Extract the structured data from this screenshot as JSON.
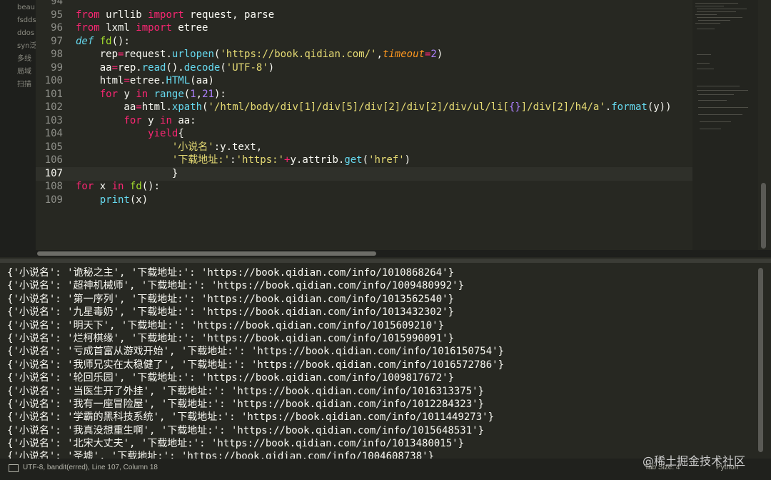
{
  "sidebar": {
    "items": [
      "beau",
      "fsdds",
      "ddos",
      "syn泛",
      "多线",
      "局域",
      "扫描"
    ]
  },
  "editor": {
    "line_numbers": [
      "94",
      "95",
      "96",
      "97",
      "98",
      "99",
      "100",
      "101",
      "102",
      "103",
      "104",
      "105",
      "106",
      "107",
      "108",
      "109"
    ],
    "active_line": "107"
  },
  "console": {
    "lines": [
      "{'小说名': '诡秘之主', '下载地址:': 'https://book.qidian.com/info/1010868264'}",
      "{'小说名': '超神机械师', '下载地址:': 'https://book.qidian.com/info/1009480992'}",
      "{'小说名': '第一序列', '下载地址:': 'https://book.qidian.com/info/1013562540'}",
      "{'小说名': '九星毒奶', '下载地址:': 'https://book.qidian.com/info/1013432302'}",
      "{'小说名': '明天下', '下载地址:': 'https://book.qidian.com/info/1015609210'}",
      "{'小说名': '烂柯棋缘', '下载地址:': 'https://book.qidian.com/info/1015990091'}",
      "{'小说名': '亏成首富从游戏开始', '下载地址:': 'https://book.qidian.com/info/1016150754'}",
      "{'小说名': '我师兄实在太稳健了', '下载地址:': 'https://book.qidian.com/info/1016572786'}",
      "{'小说名': '轮回乐园', '下载地址:': 'https://book.qidian.com/info/1009817672'}",
      "{'小说名': '当医生开了外挂', '下载地址:': 'https://book.qidian.com/info/1016313375'}",
      "{'小说名': '我有一座冒险屋', '下载地址:': 'https://book.qidian.com/info/1012284323'}",
      "{'小说名': '学霸的黑科技系统', '下载地址:': 'https://book.qidian.com/info/1011449273'}",
      "{'小说名': '我真没想重生啊', '下载地址:': 'https://book.qidian.com/info/1015648531'}",
      "{'小说名': '北宋大丈夫', '下载地址:': 'https://book.qidian.com/info/1013480015'}",
      "{'小说名': '圣墟', '下载地址:': 'https://book.qidian.com/info/1004608738'}"
    ]
  },
  "status": {
    "left": "UTF-8, bandit(erred), Line 107, Column 18",
    "tab_size": "Tab Size: 4",
    "syntax": "Python"
  },
  "watermark": "@稀土掘金技术社区",
  "colors": {
    "background": "#272822",
    "keyword": "#f92672",
    "function": "#66d9ef",
    "string": "#e6db74",
    "number": "#ae81ff",
    "green": "#a6e22e",
    "param": "#fd971f"
  }
}
